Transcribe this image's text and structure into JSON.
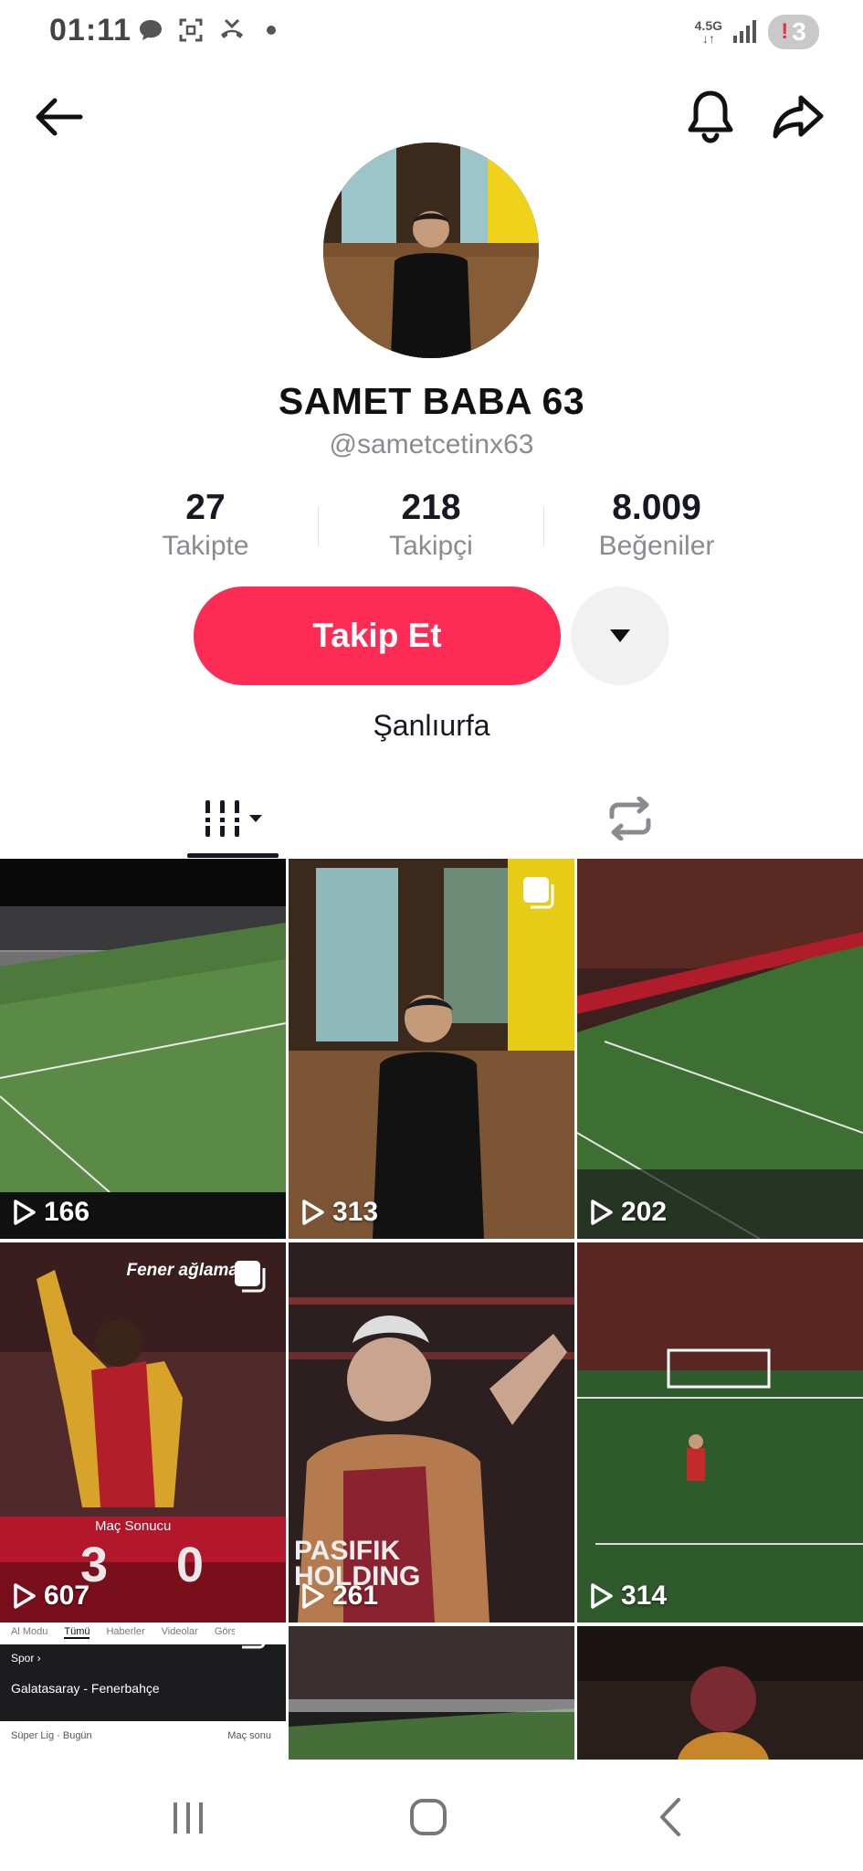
{
  "status_bar": {
    "time": "01:11",
    "network": "4.5G",
    "battery_badge": "3",
    "battery_warn": "!"
  },
  "profile": {
    "display_name": "SAMET BABA 63",
    "username": "@sametcetinx63",
    "location": "Şanlıurfa",
    "stats": [
      {
        "value": "27",
        "label": "Takipte"
      },
      {
        "value": "218",
        "label": "Takipçi"
      },
      {
        "value": "8.009",
        "label": "Beğeniler"
      }
    ],
    "follow_label": "Takip Et"
  },
  "videos": [
    {
      "views": "166"
    },
    {
      "views": "313"
    },
    {
      "views": "202"
    },
    {
      "views": "607",
      "overlay_text": "Fener ağlama",
      "score_title": "Maç Sonucu",
      "score": "3 0"
    },
    {
      "views": "261",
      "shirt_text": "PASIFIK HOLDING"
    },
    {
      "views": "314"
    },
    {
      "tabs": [
        "Al Modu",
        "Tümü",
        "Haberler",
        "Videolar",
        "Görseller"
      ],
      "card_tag": "Spor ›",
      "card_title": "Galatasaray - Fenerbahçe",
      "card_sub": "Süper Lig · Bugün",
      "card_link": "Maç sonu"
    },
    {},
    {}
  ],
  "colors": {
    "accent": "#fe2c55",
    "text": "#161823",
    "muted": "#8a8b91"
  },
  "icons": [
    "back-arrow-icon",
    "bell-icon",
    "share-icon",
    "chevron-down-icon",
    "grid-icon",
    "repost-icon",
    "play-icon"
  ]
}
